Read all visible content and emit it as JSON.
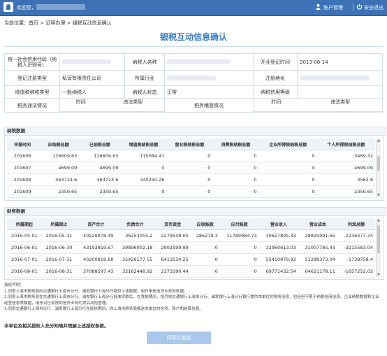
{
  "header": {
    "welcome": "欢迎您，",
    "account_label": "账户管理",
    "logout_label": "安全退出"
  },
  "breadcrumb": {
    "prefix": "当前位置：",
    "home": "首页",
    "arrow": ">",
    "level2": "证明办理",
    "level3": "银税互动信息确认"
  },
  "page_title": "银税互动信息确认",
  "info": {
    "credit_code_label": "统一社会信用代码（纳税人识别号）",
    "taxpayer_name_label": "纳税人名称",
    "open_date_label": "开业登记时间",
    "open_date_value": "2013-08-14",
    "reg_type_label": "登记注册类型",
    "reg_type_value": "私营有限责任公司",
    "industry_label": "所属行业",
    "reg_address_label": "注册地址",
    "vat_type_label": "增值税纳税类型",
    "vat_type_value": "一般纳税人",
    "status_label": "纳税人状态",
    "status_value": "正常",
    "credit_level_label": "纳税信用等级",
    "violation_label": "税务违法情况",
    "time_label": "时间",
    "violation_type_label": "违法类型",
    "audit_label": "税务稽查情况",
    "time_label2": "时间",
    "violation_type_label2": "违法类型"
  },
  "tax_section": {
    "title": "纳税数据",
    "columns": [
      "申报时间",
      "应纳税总额",
      "已纳税总额",
      "增值税纳税总额",
      "营业税纳税总额",
      "消费税纳税总额",
      "企业所得税纳税总额",
      "个人所得税纳税总额"
    ],
    "rows": [
      [
        "201606",
        "126609.63",
        "126609.63",
        "115084.41",
        "0",
        "0",
        "0",
        "3469.32"
      ],
      [
        "201607",
        "4699.09",
        "4699.09",
        "0",
        "0",
        "0",
        "0",
        "4699.09"
      ],
      [
        "201608",
        "464724.6",
        "464724.6",
        "340250.26",
        "0",
        "0",
        "0",
        "3562.8"
      ],
      [
        "201609",
        "2359.65",
        "2359.65",
        "0",
        "0",
        "0",
        "0",
        "2359.65"
      ]
    ]
  },
  "finance_section": {
    "title": "财务数据",
    "columns": [
      "所属期起",
      "所属期止",
      "资产合计",
      "负债合计",
      "货币资金",
      "应收账款",
      "应付账款",
      "营业收入",
      "营业成本",
      "利润总额"
    ],
    "rows": [
      [
        "2016-05-01",
        "2016-05-31",
        "40529978.49",
        "36253055.2",
        "2279548.05",
        "286279.3",
        "11789984.73",
        "30627805.33",
        "28825991.65",
        "-2236477.24"
      ],
      [
        "2016-06-01",
        "2016-06-30",
        "43193819.67",
        "39896002.18",
        "2902599.99",
        "0",
        "0",
        "32960613.03",
        "31007785.43",
        "-3215583.04"
      ],
      [
        "2016-07-01",
        "2016-07-31",
        "40200819.68",
        "35426177.55",
        "6413534.25",
        "0",
        "0",
        "55410979.92",
        "51288373.04",
        "-1738758.4"
      ],
      [
        "2016-08-01",
        "2016-08-31",
        "37088597.43",
        "32162448.92",
        "2373290.44",
        "0",
        "0",
        "69771432.54",
        "64621178.11",
        "-1657252.02"
      ]
    ]
  },
  "declaration": {
    "heading": "授权声明：",
    "line1": "1.同意上海市税务局向交通银行上海市分行、浦发银行上海分行提供上述数据，用作审核信贷业务的依据。",
    "line2": "2.同意上海市税务局在交通银行上海市分行、浦发银行上海分行批准贷款后，在我依期间，按月向交通银行上海市分行、浦发银行上海分行银行提供本单位的税务信息，包括但不限于纳税信用信息、企业纳税数据和企业经营信息等数据，用作对已发放的信贷业务的贷后风险管理。",
    "line3": "3.同意交通银行上海市分行、浦发银行上海分行在授信期间，向上海市税务局报送本单位的信贷、账户和结算信息。"
  },
  "agree_text": "本单位及相关授权人充分知晓并理解上述授权条款。",
  "submit_label": "同意并发送"
}
